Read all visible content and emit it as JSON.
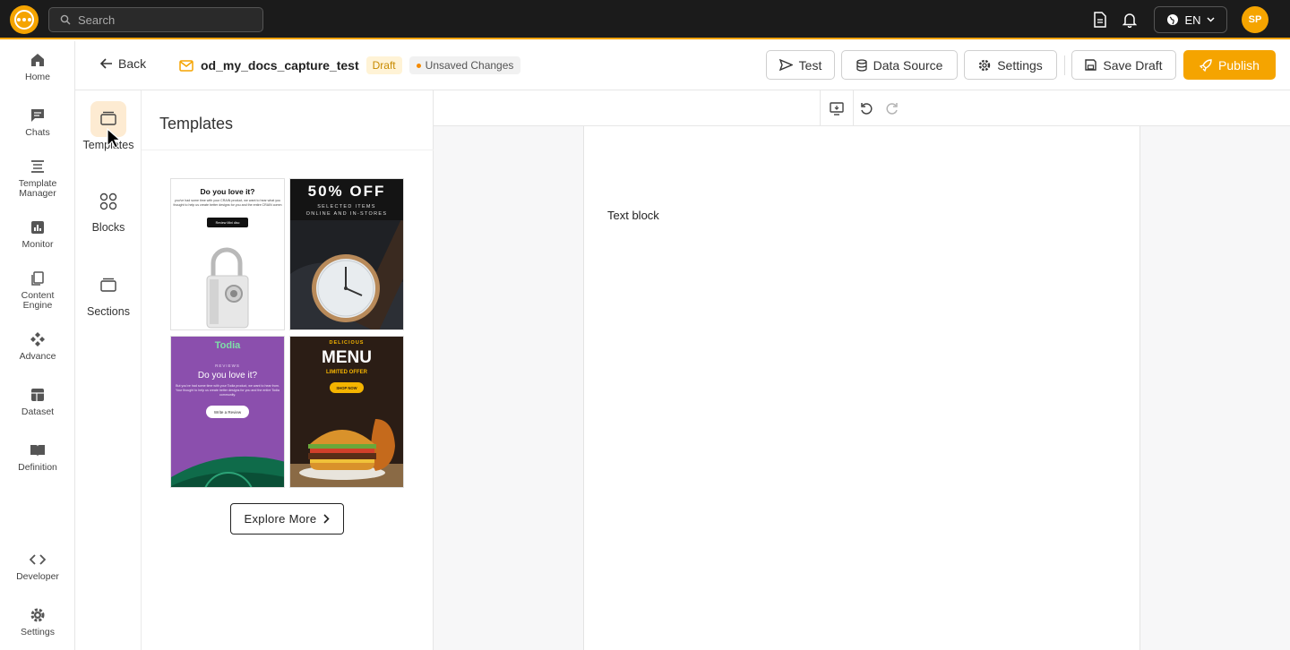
{
  "topbar": {
    "search_placeholder": "Search",
    "language": "EN",
    "avatar_initials": "SP",
    "accent_color": "#f5a400"
  },
  "leftnav": {
    "items": [
      {
        "label": "Home",
        "icon": "home-icon"
      },
      {
        "label": "Chats",
        "icon": "chat-icon"
      },
      {
        "label": "Template Manager",
        "icon": "template-manager-icon"
      },
      {
        "label": "Monitor",
        "icon": "monitor-icon"
      },
      {
        "label": "Content Engine",
        "icon": "content-engine-icon"
      },
      {
        "label": "Advance",
        "icon": "advance-icon"
      },
      {
        "label": "Dataset",
        "icon": "dataset-icon"
      },
      {
        "label": "Definition",
        "icon": "definition-icon"
      },
      {
        "label": "Developer",
        "icon": "developer-icon"
      },
      {
        "label": "Settings",
        "icon": "settings-icon"
      }
    ]
  },
  "header": {
    "back_label": "Back",
    "doc_name": "od_my_docs_capture_test",
    "status_badge": "Draft",
    "unsaved_label": "Unsaved Changes",
    "buttons": {
      "test": "Test",
      "data_source": "Data Source",
      "settings": "Settings",
      "save_draft": "Save Draft",
      "publish": "Publish"
    }
  },
  "rail": {
    "items": [
      {
        "label": "Templates",
        "active": true
      },
      {
        "label": "Blocks",
        "active": false
      },
      {
        "label": "Sections",
        "active": false
      }
    ]
  },
  "panel": {
    "title": "Templates",
    "explore_label": "Explore More",
    "templates": [
      {
        "heading": "Do you love it?",
        "body": "you've had some time with your CRAIN product, we want to hear what you thought to help us create better designs for you and the entire CRAIN comm",
        "button": "Review Mini disc"
      },
      {
        "heading": "50% OFF",
        "line1": "SELECTED ITEMS",
        "line2": "ONLINE AND IN-STORES"
      },
      {
        "brand": "Todia",
        "eyebrow": "REVIEWS",
        "heading": "Do you love it?",
        "body": "But you've had some time with your Todia product, we want to hear from. Your thought to help us create better designs for you and the entire Todia community.",
        "button": "Write a Review"
      },
      {
        "eyebrow": "DELICIOUS",
        "heading": "MENU",
        "sub": "LIMITED OFFER",
        "button": "SHOP NOW"
      }
    ]
  },
  "canvas": {
    "text_block": "Text block"
  }
}
